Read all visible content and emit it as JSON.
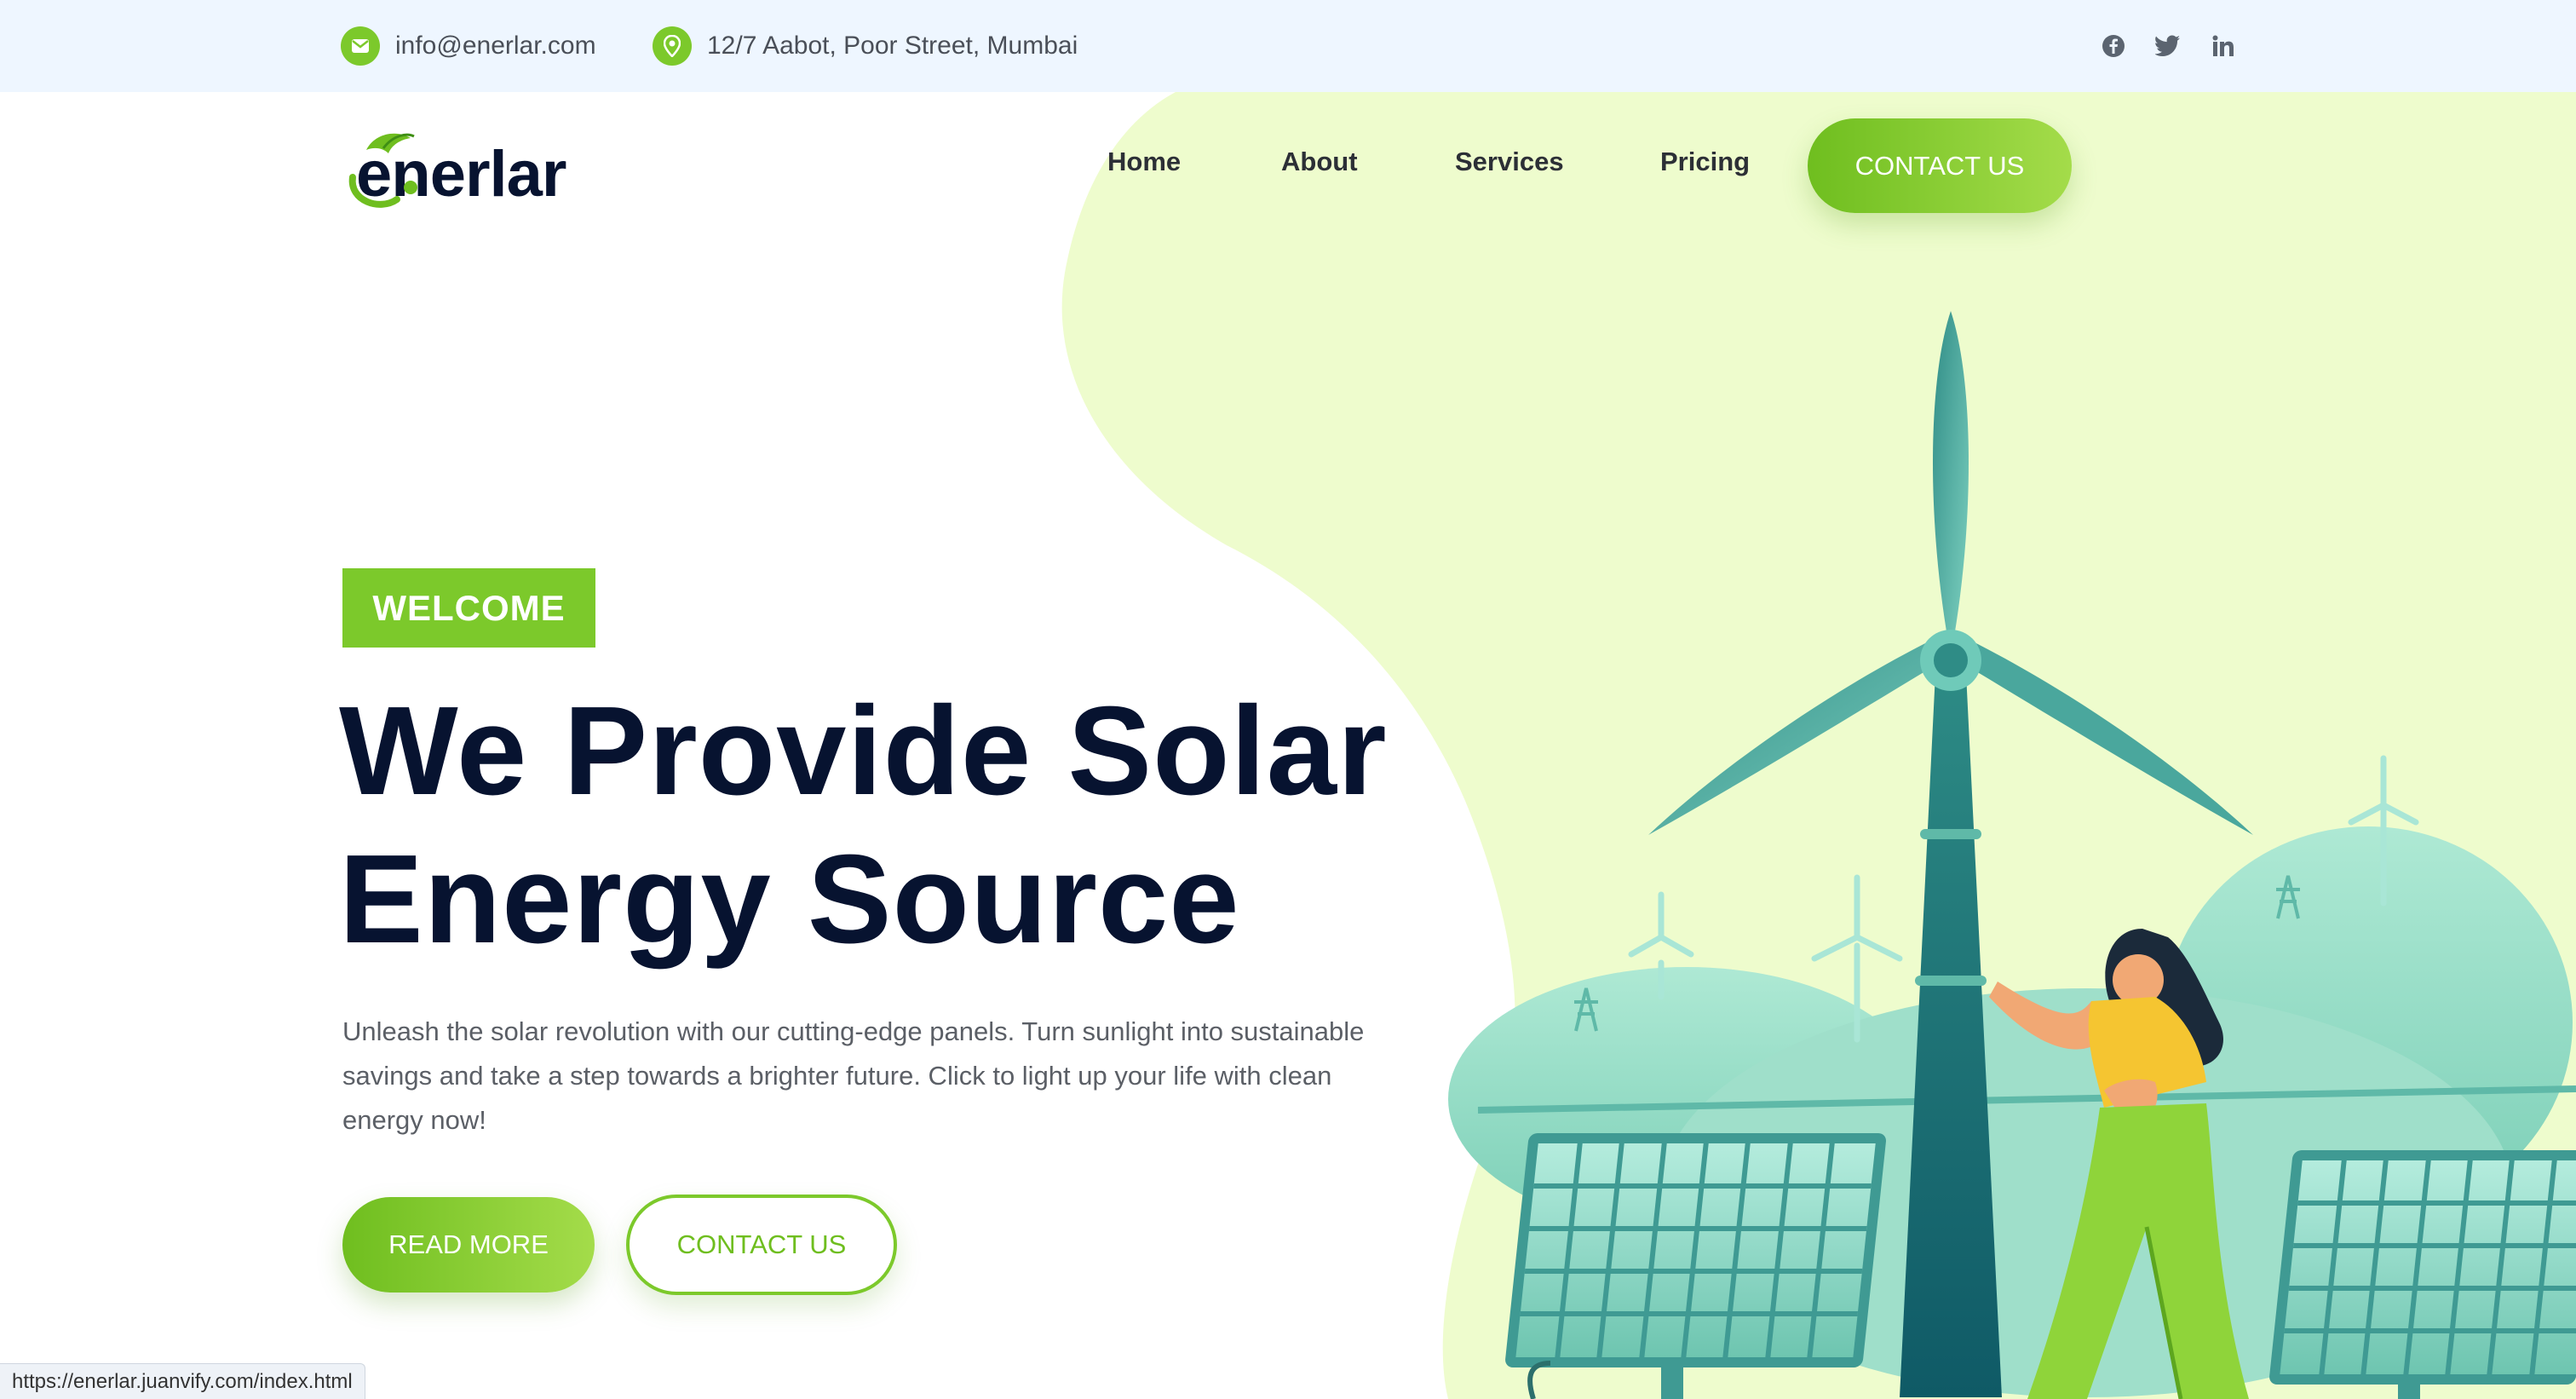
{
  "topbar": {
    "email": "info@enerlar.com",
    "address": "12/7 Aabot, Poor Street, Mumbai",
    "social": [
      "facebook-icon",
      "twitter-icon",
      "linkedin-icon"
    ]
  },
  "brand": {
    "logo_text": "enerlar"
  },
  "nav": {
    "items": [
      "Home",
      "About",
      "Services",
      "Pricing"
    ],
    "cta": "CONTACT US"
  },
  "hero": {
    "badge": "WELCOME",
    "title_line1": "We Provide Solar",
    "title_line2": "Energy Source",
    "description": "Unleash the solar revolution with our cutting-edge panels. Turn sunlight into sustainable savings and take a step towards a brighter future. Click to light up your life with clean energy now!",
    "read_more": "READ MORE",
    "contact": "CONTACT US"
  },
  "status_url": "https://enerlar.juanvify.com/index.html",
  "colors": {
    "accent": "#7cc92b",
    "heading": "#071330",
    "blob": "#eefccd",
    "teal": "#3f9a93",
    "topbar_bg": "#eef6ff"
  }
}
